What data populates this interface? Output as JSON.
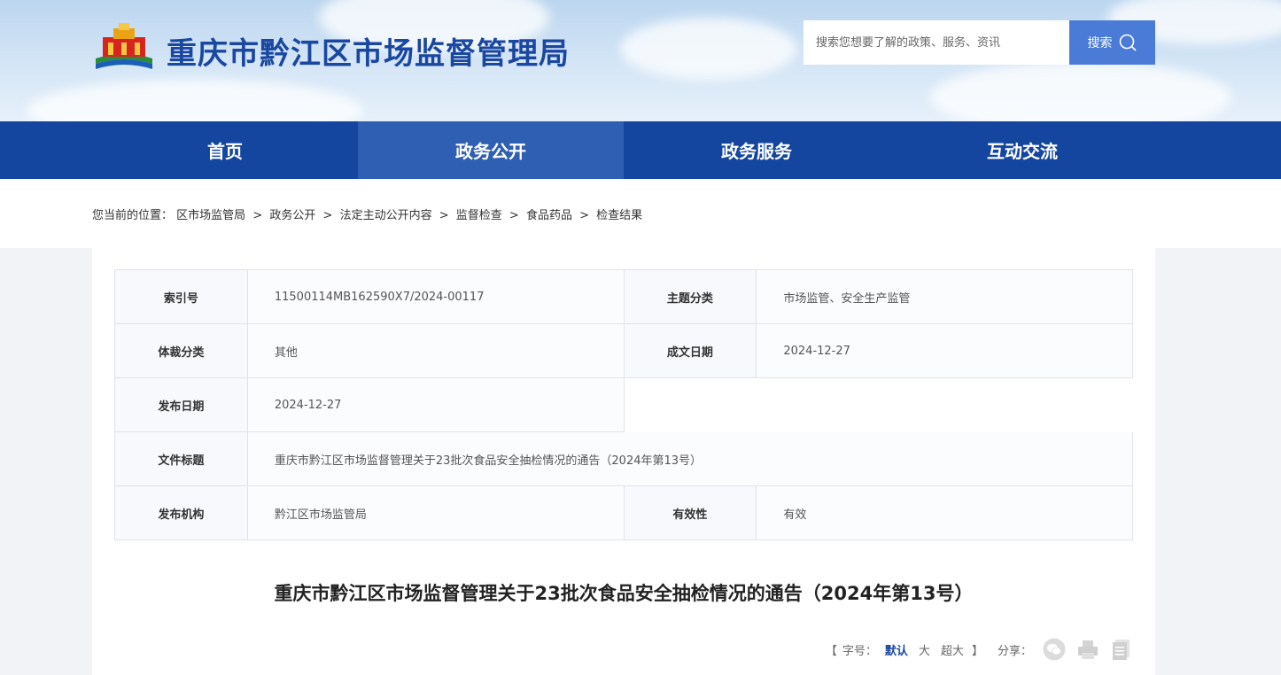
{
  "header": {
    "site_title": "重庆市黔江区市场监督管理局",
    "search_placeholder": "搜索您想要了解的政策、服务、资讯",
    "search_button": "搜索"
  },
  "nav": {
    "items": [
      {
        "label": "首页",
        "active": false
      },
      {
        "label": "政务公开",
        "active": true
      },
      {
        "label": "政务服务",
        "active": false
      },
      {
        "label": "互动交流",
        "active": false
      }
    ]
  },
  "breadcrumb": {
    "prefix": "您当前的位置：",
    "items": [
      "区市场监管局",
      "政务公开",
      "法定主动公开内容",
      "监督检查",
      "食品药品",
      "检查结果"
    ],
    "separator": ">"
  },
  "meta": {
    "index_label": "索引号",
    "index_value": "11500114MB162590X7/2024-00117",
    "topic_label": "主题分类",
    "topic_value": "市场监管、安全生产监管",
    "genre_label": "体裁分类",
    "genre_value": "其他",
    "written_label": "成文日期",
    "written_value": "2024-12-27",
    "publish_label": "发布日期",
    "publish_value": "2024-12-27",
    "title_label": "文件标题",
    "title_value": "重庆市黔江区市场监督管理关于23批次食品安全抽检情况的通告（2024年第13号）",
    "org_label": "发布机构",
    "org_value": "黔江区市场监管局",
    "validity_label": "有效性",
    "validity_value": "有效"
  },
  "document": {
    "title": "重庆市黔江区市场监督管理关于23批次食品安全抽检情况的通告（2024年第13号）"
  },
  "tools": {
    "open_bracket": "【",
    "font_label": "字号：",
    "font_default": "默认",
    "font_large": "大",
    "font_xlarge": "超大",
    "close_bracket": "】",
    "share_label": "分享："
  },
  "colors": {
    "brand": "#1446a0",
    "nav_active": "#2f5fb3",
    "search_button": "#4a7bd6"
  }
}
